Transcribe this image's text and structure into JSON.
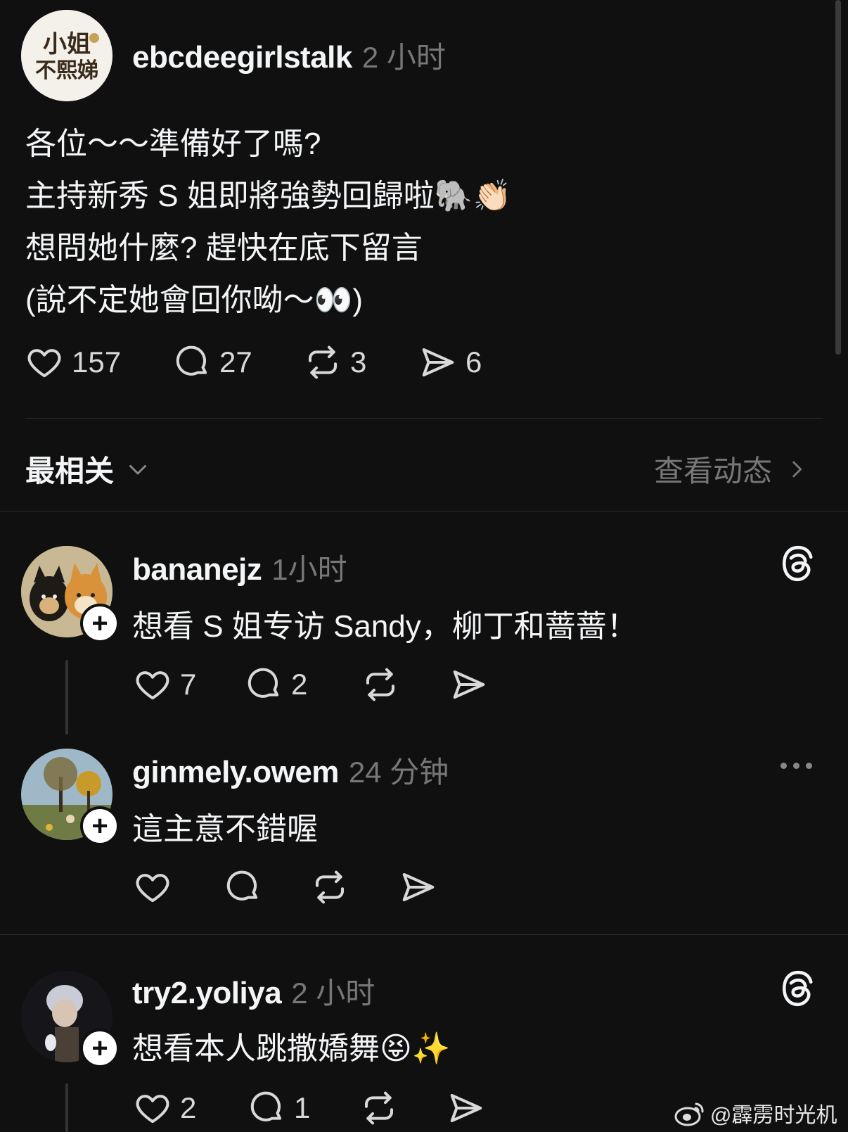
{
  "post": {
    "username": "ebcdeegirlstalk",
    "time": "2 小时",
    "lines": [
      "各位～～準備好了嗎?",
      "主持新秀 S 姐即將強勢回歸啦🐘👏🏻",
      "想問她什麼? 趕快在底下留言",
      "(說不定她會回你呦～👀)"
    ],
    "likes": "157",
    "comments": "27",
    "reposts": "3",
    "shares": "6"
  },
  "filter": {
    "sort_label": "最相关",
    "activity_label": "查看动态"
  },
  "replies": [
    {
      "username": "bananejz",
      "time": "1小时",
      "text": "想看 S 姐专访 Sandy，柳丁和蔷蔷！",
      "likes": "7",
      "comments": "2"
    },
    {
      "username": "ginmely.owem",
      "time": "24 分钟",
      "text": "這主意不錯喔"
    },
    {
      "username": "try2.yoliya",
      "time": "2 小时",
      "text": "想看本人跳撒嬌舞😝✨",
      "likes": "2",
      "comments": "1"
    }
  ],
  "watermark": "@霹雳时光机",
  "colors": {
    "background": "#101010",
    "text": "#f3f5f7",
    "muted": "#777777"
  }
}
